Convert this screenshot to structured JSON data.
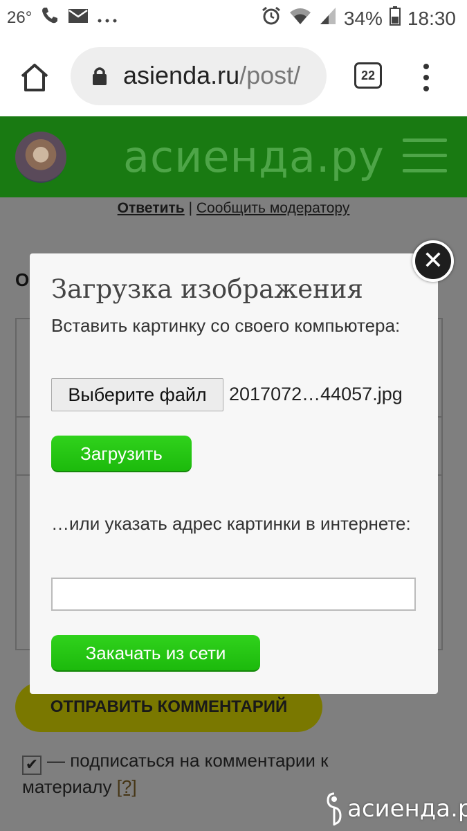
{
  "statusbar": {
    "temperature": "26°",
    "battery": "34%",
    "time": "18:30"
  },
  "browser": {
    "url_domain": "asienda.ru",
    "url_path": "/post/",
    "tab_count": "22"
  },
  "site": {
    "logo_text": "асиенда.ру"
  },
  "comment_actions": {
    "reply": "Ответить",
    "separator": "|",
    "report": "Сообщить модератору"
  },
  "background": {
    "partial_heading": "О",
    "submit_label": "ОТПРАВИТЬ КОММЕНТАРИЙ",
    "subscribe_text": "— подписаться на комментарии к материалу",
    "help_link": "[?]",
    "subscribe_checked": true
  },
  "modal": {
    "title": "Загрузка изображения",
    "local_prompt": "Вставить картинку со своего компьютера:",
    "file_button": "Выберите файл",
    "file_name": "2017072…44057.jpg",
    "upload_button": "Загрузить",
    "url_prompt": "…или указать адрес картинки в интернете:",
    "url_value": "",
    "fetch_button": "Закачать из сети",
    "close_symbol": "✕"
  },
  "watermark": "асиенда.ру",
  "colors": {
    "header_green": "#197a12",
    "button_green": "#22c411",
    "submit_yellow": "#f5f000"
  }
}
